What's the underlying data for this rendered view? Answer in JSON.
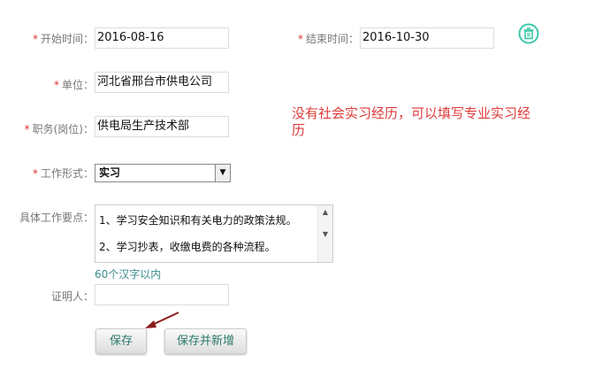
{
  "form": {
    "start_label": "开始时间：",
    "start_value": "2016-08-16",
    "end_label": "结束时间：",
    "end_value": "2016-10-30",
    "unit_label": "单位：",
    "unit_value": "河北省邢台市供电公司",
    "position_label": "职务(岗位)：",
    "position_value": "供电局生产技术部",
    "work_type_label": "工作形式：",
    "work_type_value": "实习",
    "details_label": "具体工作要点：",
    "details_lines": [
      "1、学习安全知识和有关电力的政策法规。",
      "2、学习抄表，收缴电费的各种流程。"
    ],
    "details_hint": "60个汉字以内",
    "witness_label": "证明人：",
    "witness_value": "",
    "required_mark": "*"
  },
  "annotation": "没有社会实习经历，可以填写专业实习经历",
  "buttons": {
    "save": "保存",
    "save_new": "保存并新增"
  },
  "colors": {
    "accent": "#3cc8a8",
    "annotation": "#e03a3a",
    "hint": "#3a8a8a"
  }
}
